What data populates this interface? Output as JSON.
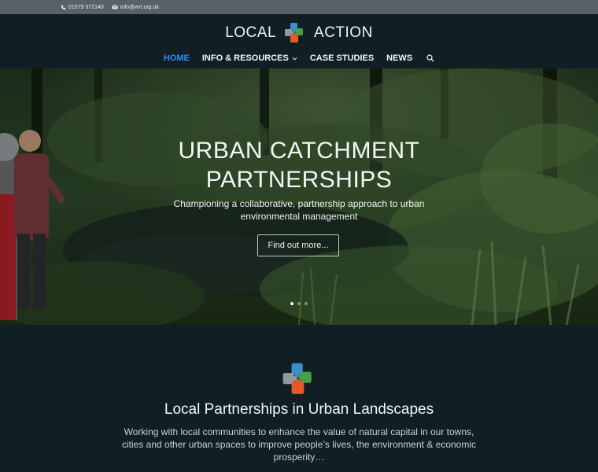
{
  "topbar": {
    "phone": "01579 372140",
    "email": "info@wrt.org.uk"
  },
  "logo": {
    "left_word": "LOCAL",
    "right_word": "ACTION",
    "puzzle_colors": [
      "#3a8fc9",
      "#8f9aa0",
      "#43a047",
      "#e8572a"
    ]
  },
  "nav": {
    "items": [
      {
        "label": "HOME"
      },
      {
        "label": "INFO & RESOURCES"
      },
      {
        "label": "CASE STUDIES"
      },
      {
        "label": "NEWS"
      }
    ],
    "active_color": "#2e8cff"
  },
  "hero": {
    "title_line1": "URBAN CATCHMENT",
    "title_line2": "PARTNERSHIPS",
    "subtitle": "Championing a collaborative, partnership approach to urban environmental management",
    "button": "Find out more...",
    "slides": 3,
    "active_slide": 1
  },
  "intro": {
    "heading": "Local Partnerships in Urban Landscapes",
    "body": "Working with local communities to enhance the value of natural capital in our towns, cities and other urban spaces to improve people’s lives, the environment & economic prosperity…"
  }
}
